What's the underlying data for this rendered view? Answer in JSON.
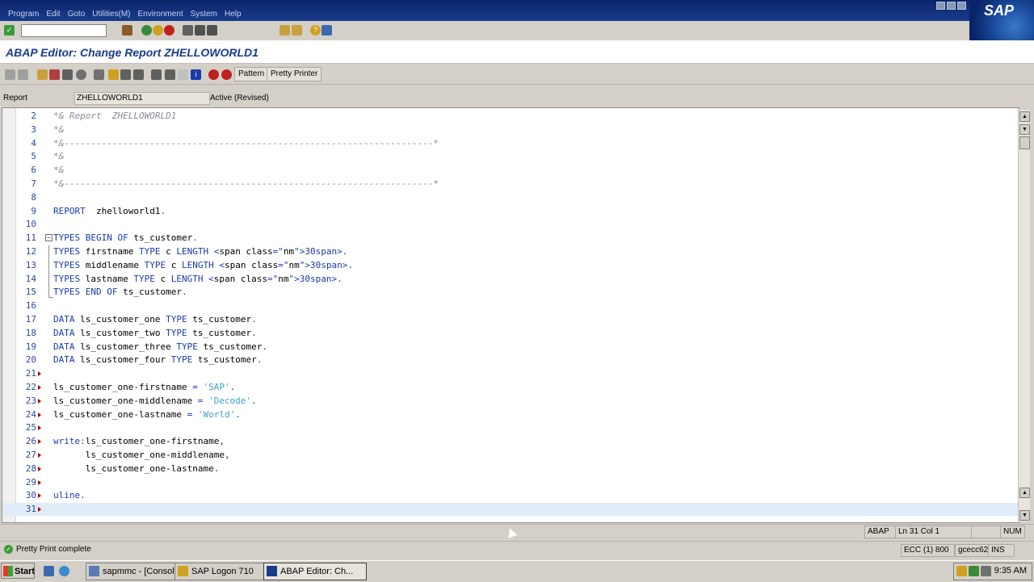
{
  "menu": {
    "items": [
      "Program",
      "Edit",
      "Goto",
      "Utilities(M)",
      "Environment",
      "System",
      "Help"
    ],
    "logo": "SAP"
  },
  "standard_toolbar": {
    "command_field_value": "",
    "icons": [
      "check-icon",
      "save-icon",
      "back-icon",
      "exit-icon",
      "cancel-icon",
      "print-icon",
      "find-icon",
      "help-icon"
    ]
  },
  "title": "ABAP Editor: Change Report ZHELLOWORLD1",
  "app_toolbar": {
    "pattern_label": "Pattern",
    "pretty_printer_label": "Pretty Printer"
  },
  "report": {
    "label": "Report",
    "value": "ZHELLOWORLD1",
    "status": "Active (Revised)"
  },
  "editor": {
    "current_line": 31,
    "lines": [
      {
        "n": "2",
        "t": "*& Report  ZHELLOWORLD1"
      },
      {
        "n": "3",
        "t": "*&"
      },
      {
        "n": "4",
        "t": "*&---------------------------------------------------------------------*"
      },
      {
        "n": "5",
        "t": "*&"
      },
      {
        "n": "6",
        "t": "*&"
      },
      {
        "n": "7",
        "t": "*&---------------------------------------------------------------------*"
      },
      {
        "n": "8",
        "t": ""
      },
      {
        "n": "9",
        "t": "REPORT  zhelloworld1."
      },
      {
        "n": "10",
        "t": ""
      },
      {
        "n": "11",
        "t": "TYPES BEGIN OF ts_customer."
      },
      {
        "n": "12",
        "t": "TYPES firstname TYPE c LENGTH 30."
      },
      {
        "n": "13",
        "t": "TYPES middlename TYPE c LENGTH 30."
      },
      {
        "n": "14",
        "t": "TYPES lastname TYPE c LENGTH 30."
      },
      {
        "n": "15",
        "t": "TYPES END OF ts_customer."
      },
      {
        "n": "16",
        "t": ""
      },
      {
        "n": "17",
        "t": "DATA ls_customer_one TYPE ts_customer."
      },
      {
        "n": "18",
        "t": "DATA ls_customer_two TYPE ts_customer."
      },
      {
        "n": "19",
        "t": "DATA ls_customer_three TYPE ts_customer."
      },
      {
        "n": "20",
        "t": "DATA ls_customer_four TYPE ts_customer."
      },
      {
        "n": "21",
        "t": ""
      },
      {
        "n": "22",
        "t": "ls_customer_one-firstname = 'SAP'."
      },
      {
        "n": "23",
        "t": "ls_customer_one-middlename = 'Decode'."
      },
      {
        "n": "24",
        "t": "ls_customer_one-lastname = 'World'."
      },
      {
        "n": "25",
        "t": ""
      },
      {
        "n": "26",
        "t": "write:ls_customer_one-firstname,"
      },
      {
        "n": "27",
        "t": "      ls_customer_one-middlename,"
      },
      {
        "n": "28",
        "t": "      ls_customer_one-lastname."
      },
      {
        "n": "29",
        "t": ""
      },
      {
        "n": "30",
        "t": "uline."
      },
      {
        "n": "31",
        "t": ""
      }
    ]
  },
  "status_bar": {
    "language": "ABAP",
    "position": "Ln  31 Col  1",
    "num": "NUM",
    "message": "Pretty Print complete",
    "system": "ECC (1) 800",
    "server": "gcecc62",
    "mode": "INS"
  },
  "taskbar": {
    "start_label": "Start",
    "tasks": [
      "sapmmc - [Consol...",
      "SAP Logon 710",
      "ABAP Editor: Ch..."
    ],
    "clock": "9:35 AM"
  }
}
